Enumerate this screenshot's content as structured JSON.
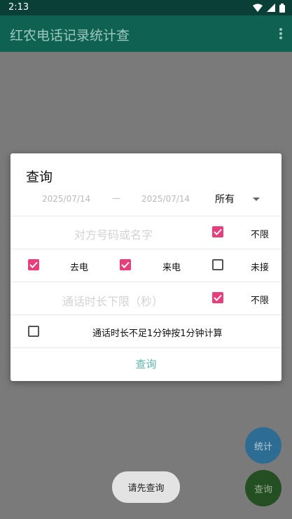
{
  "status_bar": {
    "time": "2:13"
  },
  "app_bar": {
    "title": "红农电话记录统计查"
  },
  "dialog": {
    "title": "查询",
    "date_start": "2025/07/14",
    "date_sep": "—",
    "date_end": "2025/07/14",
    "spinner_value": "所有",
    "contact_placeholder": "对方号码或名字",
    "contact_unlimited_label": "不限",
    "outgoing_label": "去电",
    "incoming_label": "来电",
    "missed_label": "未接",
    "duration_placeholder": "通话时长下限（秒）",
    "duration_unlimited_label": "不限",
    "round_minute_label": "通话时长不足1分钟按1分钟计算",
    "query_button": "查询"
  },
  "fab": {
    "stats_label": "统计",
    "query_label": "查询"
  },
  "toast": {
    "text": "请先查询"
  },
  "checkbox_states": {
    "contact_unlimited": true,
    "outgoing": true,
    "incoming": true,
    "missed": false,
    "duration_unlimited": true,
    "round_minute": false
  }
}
